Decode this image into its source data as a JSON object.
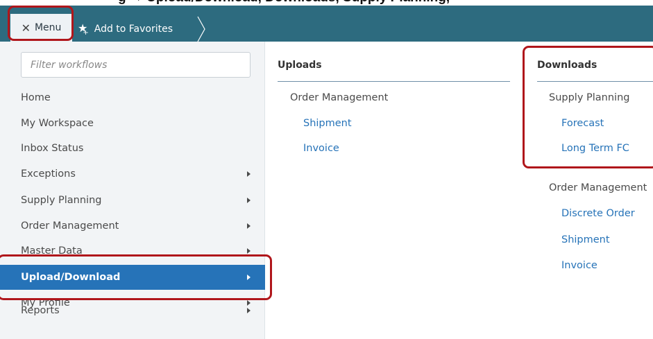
{
  "caption": "g → Upload/Download, Downloads, Supply Planning,",
  "topbar": {
    "menu_label": "Menu",
    "favorites_label": "Add to Favorites"
  },
  "sidebar": {
    "filter_placeholder": "Filter workflows",
    "items": [
      {
        "label": "Home"
      },
      {
        "label": "My Workspace"
      },
      {
        "label": "Inbox Status"
      },
      {
        "label": "Exceptions"
      },
      {
        "label": "Supply Planning"
      },
      {
        "label": "Order Management"
      },
      {
        "label": "Master Data"
      },
      {
        "label": "Upload/Download"
      },
      {
        "label": "My Profile"
      },
      {
        "label": "Reports"
      }
    ]
  },
  "uploads": {
    "heading": "Uploads",
    "groups": [
      {
        "label": "Order Management",
        "links": [
          "Shipment",
          "Invoice"
        ]
      }
    ]
  },
  "downloads": {
    "heading": "Downloads",
    "groups": [
      {
        "label": "Supply Planning",
        "links": [
          "Forecast",
          "Long Term FC"
        ]
      },
      {
        "label": "Order Management",
        "links": [
          "Discrete Order",
          "Shipment",
          "Invoice"
        ]
      }
    ]
  },
  "colors": {
    "topbar": "#2d6b7f",
    "active_item": "#2673b8",
    "link": "#2673b8",
    "highlight": "#b0161b"
  }
}
